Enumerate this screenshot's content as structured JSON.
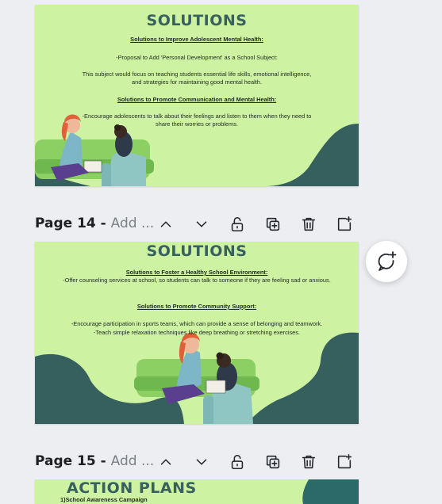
{
  "slides": [
    {
      "title": "SOLUTIONS",
      "lines": [
        "Solutions to Improve Adolescent Mental Health:",
        "-Proposal to Add 'Personal Development' as a School Subject:",
        "This subject would focus on teaching students essential life skills, emotional intelligence,",
        "and strategies for maintaining good mental health.",
        "Solutions to Promote Communication and Mental Health:",
        "-Encourage adolescents to talk about their feelings and listen to them when they need to",
        "share their worries or problems."
      ]
    },
    {
      "title": "SOLUTIONS",
      "lines": [
        "Solutions to Foster a Healthy School Environment:",
        "-Offer counseling services at school, so students can talk to someone if they are feeling sad or anxious.",
        "Solutions to Promote Community Support:",
        "-Encourage participation in sports teams, which can provide a sense of belonging and teamwork.",
        "-Teach simple relaxation techniques like deep breathing or stretching exercises."
      ]
    },
    {
      "title": "ACTION PLANS",
      "lines": [
        "1)School Awareness Campaign"
      ]
    }
  ],
  "pages": [
    {
      "number_label": "Page 14",
      "separator": " - ",
      "title_placeholder": "Add ..."
    },
    {
      "number_label": "Page 15",
      "separator": " - ",
      "title_placeholder": "Add ..."
    }
  ],
  "icons": {
    "move_up": "chevron-up-icon",
    "move_down": "chevron-down-icon",
    "lock": "lock-icon",
    "duplicate": "duplicate-icon",
    "delete": "trash-icon",
    "add_page": "add-page-icon",
    "comment": "add-comment-icon"
  },
  "colors": {
    "slide_bg": "#cdf2a2",
    "title_teal": "#37605f",
    "dark_teal_shape": "#36605e",
    "sofa_green": "#8ccf63",
    "chair_blue": "#8fc6c4",
    "app_bg": "#eceef2"
  }
}
